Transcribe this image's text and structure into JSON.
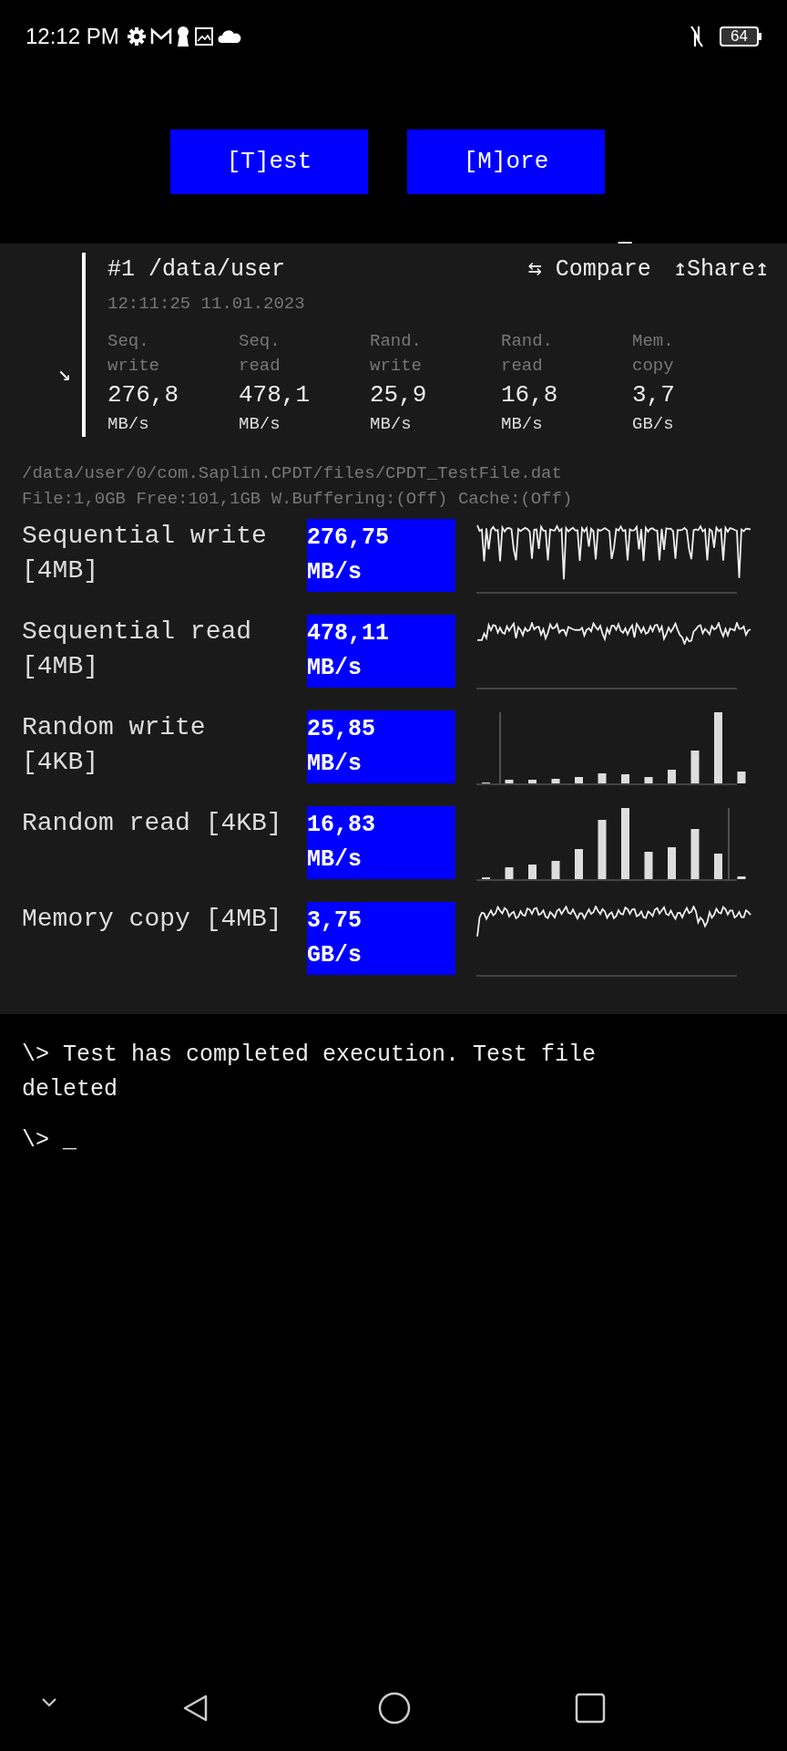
{
  "status_bar": {
    "time": "12:12 PM",
    "battery": "64"
  },
  "buttons": [
    "[T]est",
    "[M]ore"
  ],
  "cursor": "_",
  "result_header": {
    "toggle": "↘",
    "title": "#1 /data/user",
    "compare": "⇆ Compare",
    "share": "↥Share↥",
    "timestamp": "12:11:25 11.01.2023",
    "metrics": [
      {
        "label_1": "Seq.",
        "label_2": "write",
        "value": "276,8",
        "unit": "MB/s"
      },
      {
        "label_1": "Seq.",
        "label_2": "read",
        "value": "478,1",
        "unit": "MB/s"
      },
      {
        "label_1": "Rand.",
        "label_2": "write",
        "value": "25,9",
        "unit": "MB/s"
      },
      {
        "label_1": "Rand.",
        "label_2": "read",
        "value": "16,8",
        "unit": "MB/s"
      },
      {
        "label_1": "Mem.",
        "label_2": "copy",
        "value": "3,7",
        "unit": "GB/s"
      }
    ]
  },
  "file_info": [
    "/data/user/0/com.Saplin.CPDT/files/CPDT_TestFile.dat",
    "File:1,0GB Free:101,1GB W.Buffering:(Off) Cache:(Off)"
  ],
  "tests": [
    {
      "name": "Sequential write [4MB]",
      "value": "276,75",
      "unit": "MB/s",
      "kind": "sparkline"
    },
    {
      "name": "Sequential read [4MB]",
      "value": "478,11",
      "unit": "MB/s",
      "kind": "sparkline"
    },
    {
      "name": "Random write [4KB]",
      "value": "25,85",
      "unit": "MB/s",
      "kind": "bars"
    },
    {
      "name": "Random read [4KB]",
      "value": "16,83",
      "unit": "MB/s",
      "kind": "bars"
    },
    {
      "name": "Memory copy [4MB]",
      "value": "3,75",
      "unit": "GB/s",
      "kind": "sparkline"
    }
  ],
  "console": [
    "\\> Test has completed execution. Test file deleted",
    "\\> _"
  ]
}
